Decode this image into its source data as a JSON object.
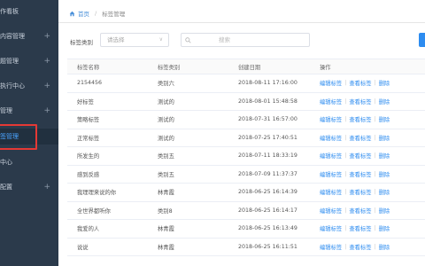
{
  "sidebar": {
    "items": [
      {
        "label": "作看板",
        "has_plus": false,
        "active": false
      },
      {
        "label": "内容管理",
        "has_plus": true,
        "active": false
      },
      {
        "label": "题管理",
        "has_plus": true,
        "active": false
      },
      {
        "label": "执行中心",
        "has_plus": true,
        "active": false
      },
      {
        "label": "管理",
        "has_plus": true,
        "active": false
      },
      {
        "label": "签管理",
        "has_plus": false,
        "active": true
      },
      {
        "label": "中心",
        "has_plus": false,
        "active": false
      },
      {
        "label": "配置",
        "has_plus": true,
        "active": false
      }
    ],
    "plus_glyph": "+"
  },
  "breadcrumb": {
    "home": "首页",
    "separator": "/",
    "current": "标签管理"
  },
  "filter": {
    "label": "标签类别",
    "select_placeholder": "请选择",
    "search_placeholder": "搜索"
  },
  "table": {
    "headers": {
      "name": "标签名称",
      "type": "标签类别",
      "date": "创建日期",
      "ops": "操作"
    },
    "ops_labels": {
      "edit": "编辑标签",
      "view": "查看标签",
      "delete": "删除",
      "separator": "|"
    },
    "rows": [
      {
        "name": "2154456",
        "type": "类别六",
        "date": "2018-08-11 17:16:00"
      },
      {
        "name": "好标签",
        "type": "测试的",
        "date": "2018-08-01 15:48:58"
      },
      {
        "name": "策略标签",
        "type": "测试的",
        "date": "2018-07-31 16:57:00"
      },
      {
        "name": "正常标签",
        "type": "测试的",
        "date": "2018-07-25 17:40:51"
      },
      {
        "name": "所发生的",
        "type": "类别五",
        "date": "2018-07-11 18:33:19"
      },
      {
        "name": "感到反感",
        "type": "类别五",
        "date": "2018-07-09 11:37:37"
      },
      {
        "name": "我理理来说的你",
        "type": "林青霞",
        "date": "2018-06-25 16:14:39"
      },
      {
        "name": "全世界都听你",
        "type": "类别8",
        "date": "2018-06-25 16:14:17"
      },
      {
        "name": "我爱的人",
        "type": "林青霞",
        "date": "2018-06-25 16:13:49"
      },
      {
        "name": "说说",
        "type": "林青霞",
        "date": "2018-06-25 16:11:51"
      }
    ]
  },
  "colors": {
    "sidebar_bg": "#2b3a4b",
    "accent": "#2d8cf0",
    "highlight_box": "#e53935"
  }
}
